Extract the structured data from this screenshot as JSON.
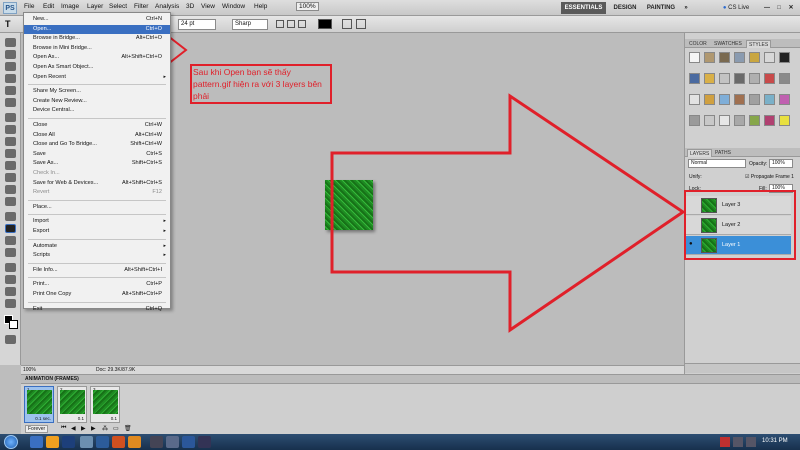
{
  "app": {
    "logo": "PS"
  },
  "menubar": {
    "items": [
      "File",
      "Edit",
      "Image",
      "Layer",
      "Select",
      "Filter",
      "Analysis",
      "3D",
      "View",
      "Window",
      "Help"
    ],
    "zoom": "100%",
    "workspaces": [
      "ESSENTIALS",
      "DESIGN",
      "PAINTING",
      "»"
    ],
    "cslive": "CS Live"
  },
  "options": {
    "font_size": "24 pt",
    "antialias": "Sharp"
  },
  "file_menu": {
    "items": [
      {
        "label": "New...",
        "shortcut": "Ctrl+N"
      },
      {
        "label": "Open...",
        "shortcut": "Ctrl+O",
        "selected": true
      },
      {
        "label": "Browse in Bridge...",
        "shortcut": "Alt+Ctrl+O"
      },
      {
        "label": "Browse in Mini Bridge...",
        "shortcut": ""
      },
      {
        "label": "Open As...",
        "shortcut": "Alt+Shift+Ctrl+O"
      },
      {
        "label": "Open As Smart Object...",
        "shortcut": ""
      },
      {
        "label": "Open Recent",
        "shortcut": "",
        "submenu": true
      },
      {
        "sep": true
      },
      {
        "label": "Share My Screen...",
        "shortcut": ""
      },
      {
        "label": "Create New Review...",
        "shortcut": ""
      },
      {
        "label": "Device Central...",
        "shortcut": ""
      },
      {
        "sep": true
      },
      {
        "label": "Close",
        "shortcut": "Ctrl+W"
      },
      {
        "label": "Close All",
        "shortcut": "Alt+Ctrl+W"
      },
      {
        "label": "Close and Go To Bridge...",
        "shortcut": "Shift+Ctrl+W"
      },
      {
        "label": "Save",
        "shortcut": "Ctrl+S"
      },
      {
        "label": "Save As...",
        "shortcut": "Shift+Ctrl+S"
      },
      {
        "label": "Check In...",
        "shortcut": "",
        "disabled": true
      },
      {
        "label": "Save for Web & Devices...",
        "shortcut": "Alt+Shift+Ctrl+S"
      },
      {
        "label": "Revert",
        "shortcut": "F12",
        "disabled": true
      },
      {
        "sep": true
      },
      {
        "label": "Place...",
        "shortcut": ""
      },
      {
        "sep": true
      },
      {
        "label": "Import",
        "shortcut": "",
        "submenu": true
      },
      {
        "label": "Export",
        "shortcut": "",
        "submenu": true
      },
      {
        "sep": true
      },
      {
        "label": "Automate",
        "shortcut": "",
        "submenu": true
      },
      {
        "label": "Scripts",
        "shortcut": "",
        "submenu": true
      },
      {
        "sep": true
      },
      {
        "label": "File Info...",
        "shortcut": "Alt+Shift+Ctrl+I"
      },
      {
        "sep": true
      },
      {
        "label": "Print...",
        "shortcut": "Ctrl+P"
      },
      {
        "label": "Print One Copy",
        "shortcut": "Alt+Shift+Ctrl+P"
      },
      {
        "sep": true
      },
      {
        "label": "Exit",
        "shortcut": "Ctrl+Q"
      }
    ]
  },
  "annotation": {
    "text": "Sau khi Open bạn sẽ thấy pattern.gif hiện ra với 3 layers bên phải"
  },
  "panels": {
    "top_tabs": [
      "COLOR",
      "SWATCHES",
      "STYLES"
    ],
    "layer_tabs": [
      "LAYERS",
      "PATHS"
    ],
    "blend_mode": "Normal",
    "opacity_label": "Opacity:",
    "opacity": "100%",
    "unify_label": "Unify:",
    "propagate": "Propagate Frame 1",
    "lock_label": "Lock:",
    "fill_label": "Fill:",
    "fill": "100%",
    "layers": [
      "Layer 3",
      "Layer 2",
      "Layer 1"
    ]
  },
  "docbar": {
    "zoom": "100%",
    "doc": "Doc: 29.3K/87.9K"
  },
  "animation": {
    "title": "ANIMATION (FRAMES)",
    "frames": [
      {
        "n": "1",
        "d": "0.1 sec."
      },
      {
        "n": "2",
        "d": "0.1"
      },
      {
        "n": "3",
        "d": "0.1"
      }
    ],
    "loop": "Forever"
  },
  "taskbar": {
    "time": "10:31 PM"
  },
  "colors": {
    "annotation_red": "#e0202a",
    "selected_blue": "#3a6fc1",
    "layer_selected": "#3b8fd8"
  }
}
